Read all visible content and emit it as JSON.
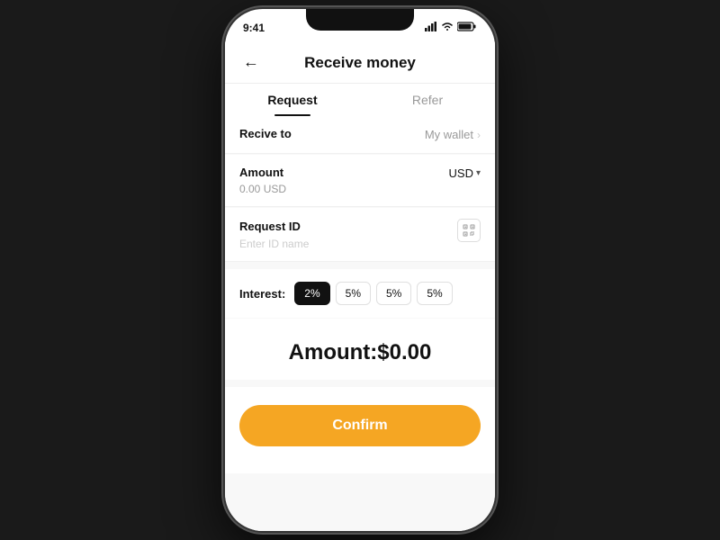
{
  "status_bar": {
    "time": "9:41",
    "signal": "●●●",
    "wifi": "wifi",
    "battery": "battery"
  },
  "header": {
    "title": "Receive money",
    "back_label": "←"
  },
  "tabs": [
    {
      "id": "request",
      "label": "Request",
      "active": true
    },
    {
      "id": "refer",
      "label": "Refer",
      "active": false
    }
  ],
  "fields": {
    "receive_to": {
      "label": "Recive to",
      "value": "My wallet"
    },
    "amount": {
      "label": "Amount",
      "currency": "USD",
      "sub_value": "0.00 USD"
    },
    "request_id": {
      "label": "Request ID",
      "placeholder": "Enter ID name"
    }
  },
  "interest": {
    "label": "Interest:",
    "options": [
      {
        "value": "2%",
        "active": true
      },
      {
        "value": "5%",
        "active": false
      },
      {
        "value": "5%",
        "active": false
      },
      {
        "value": "5%",
        "active": false
      }
    ]
  },
  "amount_display": {
    "label": "Amount:$0.00"
  },
  "confirm_button": {
    "label": "Confirm"
  },
  "colors": {
    "accent": "#f5a623",
    "dark": "#111111",
    "light_bg": "#f8f8f8"
  }
}
